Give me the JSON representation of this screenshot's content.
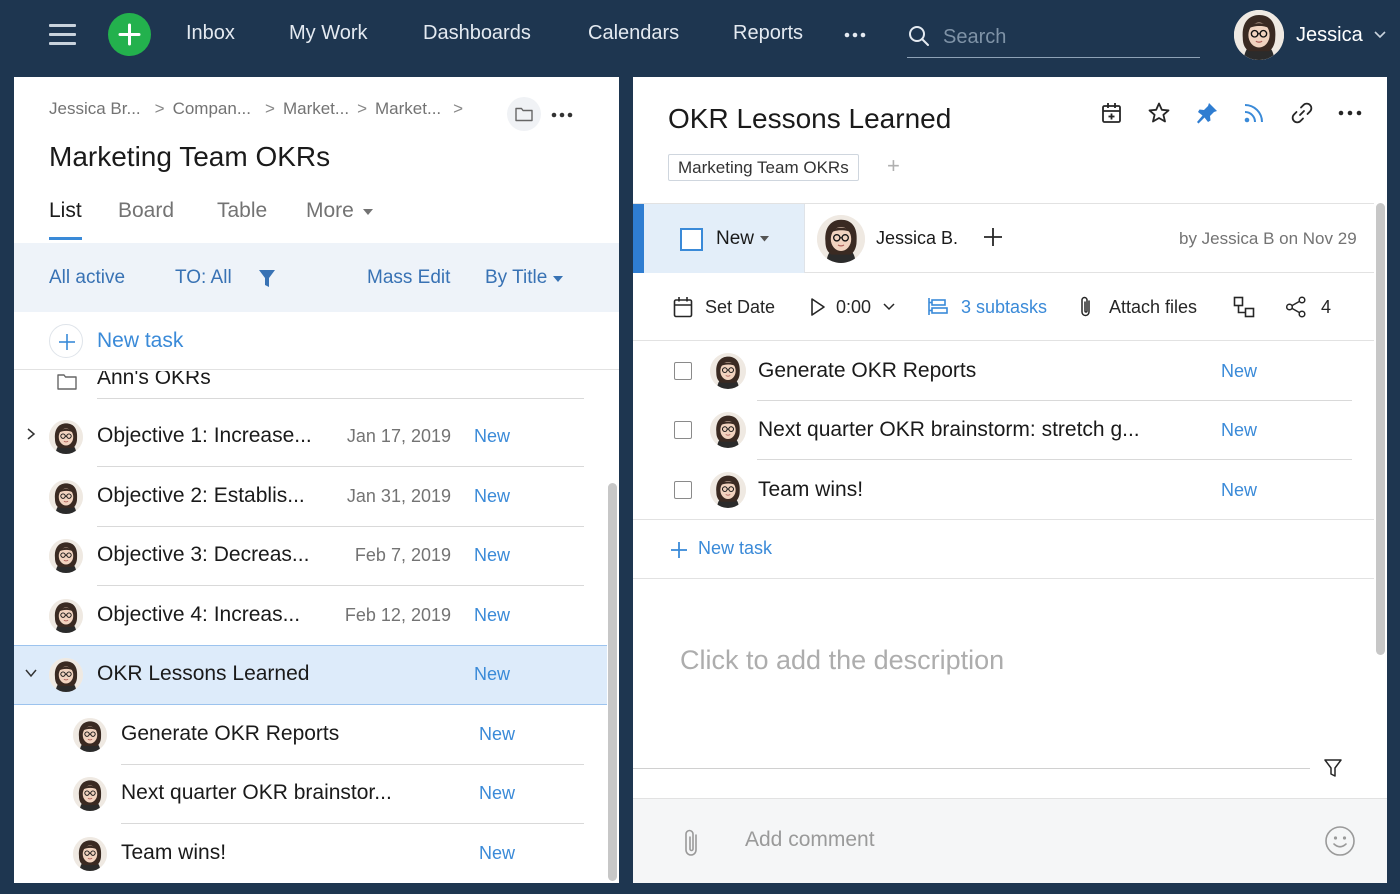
{
  "topbar": {
    "nav": [
      "Inbox",
      "My Work",
      "Dashboards",
      "Calendars",
      "Reports"
    ],
    "search_placeholder": "Search",
    "user_name": "Jessica"
  },
  "left": {
    "breadcrumbs": [
      "Jessica Br...",
      "Compan...",
      "Market...",
      "Market..."
    ],
    "title": "Marketing Team OKRs",
    "tabs": [
      "List",
      "Board",
      "Table",
      "More"
    ],
    "filters": {
      "all_active": "All active",
      "to_all": "TO: All",
      "mass_edit": "Mass Edit",
      "by_title": "By Title"
    },
    "new_task": "New task",
    "group_name": "Ann's OKRs",
    "tasks": [
      {
        "name": "Objective 1: Increase...",
        "date": "Jan 17, 2019",
        "status": "New"
      },
      {
        "name": "Objective 2: Establis...",
        "date": "Jan 31, 2019",
        "status": "New"
      },
      {
        "name": "Objective 3: Decreas...",
        "date": "Feb 7, 2019",
        "status": "New"
      },
      {
        "name": "Objective 4: Increas...",
        "date": "Feb 12, 2019",
        "status": "New"
      },
      {
        "name": "OKR Lessons Learned",
        "date": "",
        "status": "New"
      }
    ],
    "subtasks": [
      {
        "name": "Generate OKR Reports",
        "status": "New"
      },
      {
        "name": "Next quarter OKR brainstor...",
        "status": "New"
      },
      {
        "name": "Team wins!",
        "status": "New"
      }
    ]
  },
  "right": {
    "title": "OKR Lessons Learned",
    "folder_tag": "Marketing Team OKRs",
    "status": "New",
    "assignee": "Jessica B.",
    "created_by": "by Jessica B on Nov 29",
    "actions": {
      "set_date": "Set Date",
      "timer": "0:00",
      "subtasks": "3 subtasks",
      "attach": "Attach files",
      "shares": "4"
    },
    "subtasks": [
      {
        "name": "Generate OKR Reports",
        "status": "New"
      },
      {
        "name": "Next quarter OKR brainstorm: stretch g...",
        "status": "New"
      },
      {
        "name": "Team wins!",
        "status": "New"
      }
    ],
    "new_task": "New task",
    "description_placeholder": "Click to add the description",
    "comment_placeholder": "Add comment"
  },
  "colors": {
    "topbar_bg": "#1e3650",
    "accent_blue": "#3a8ad8",
    "plus_green": "#23b14d",
    "selected_row": "#ddebfa"
  }
}
